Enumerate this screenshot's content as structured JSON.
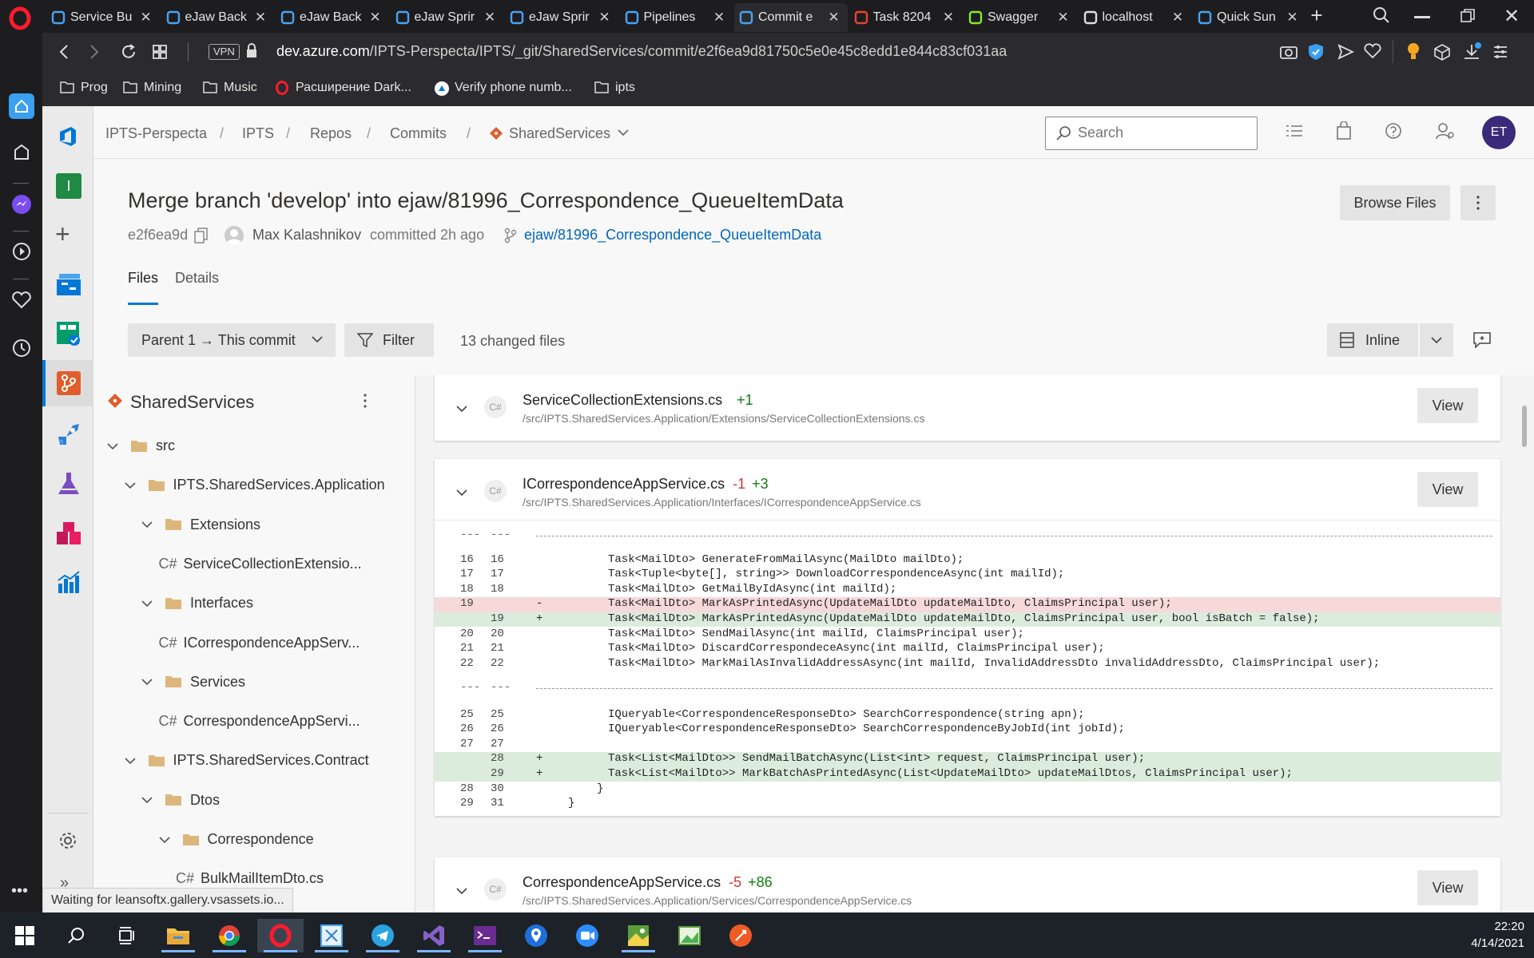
{
  "browser": {
    "tabs": [
      {
        "title": "Service Bu",
        "icon": "azure-devops-icon",
        "color": "#4aa3f0"
      },
      {
        "title": "eJaw Back",
        "icon": "azure-devops-icon",
        "color": "#4aa3f0"
      },
      {
        "title": "eJaw Back",
        "icon": "azure-devops-icon",
        "color": "#4aa3f0"
      },
      {
        "title": "eJaw Sprir",
        "icon": "azure-devops-icon",
        "color": "#4aa3f0"
      },
      {
        "title": "eJaw Sprir",
        "icon": "azure-devops-icon",
        "color": "#4aa3f0"
      },
      {
        "title": "Pipelines",
        "icon": "azure-pipelines-icon",
        "color": "#4aa3f0"
      },
      {
        "title": "Commit e",
        "icon": "azure-devops-icon",
        "color": "#4aa3f0"
      },
      {
        "title": "Task 8204",
        "icon": "gmail-icon",
        "color": "#ea4335"
      },
      {
        "title": "Swagger",
        "icon": "swagger-icon",
        "color": "#85ea2d"
      },
      {
        "title": "localhost",
        "icon": "document-icon",
        "color": "#dddddd"
      },
      {
        "title": "Quick Sun",
        "icon": "checkbox-icon",
        "color": "#4aa3f0"
      }
    ],
    "url_host": "dev.azure.com",
    "url_path": "/IPTS-Perspecta/IPTS/_git/SharedServices/commit/e2f6ea9d81750c5e0e45c8edd1e844c83cf031aa",
    "vpn_label": "VPN",
    "bookmarks": [
      {
        "label": "Prog",
        "icon": "folder-icon"
      },
      {
        "label": "Mining",
        "icon": "folder-icon"
      },
      {
        "label": "Music",
        "icon": "folder-icon"
      },
      {
        "label": "Расширение Dark...",
        "icon": "opera-icon"
      },
      {
        "label": "Verify phone numb...",
        "icon": "azure-icon"
      },
      {
        "label": "ipts",
        "icon": "folder-icon"
      }
    ],
    "status_text": "Waiting for leansoftx.gallery.vsassets.io..."
  },
  "header": {
    "breadcrumbs": [
      "IPTS-Perspecta",
      "IPTS",
      "Repos",
      "Commits",
      "SharedServices"
    ],
    "search_placeholder": "Search",
    "avatar_initials": "ET",
    "avatar_color": "#3b2a7a"
  },
  "commit": {
    "title": "Merge branch 'develop' into ejaw/81996_Correspondence_QueueItemData",
    "hash": "e2f6ea9d",
    "author": "Max Kalashnikov",
    "action": "committed 2h ago",
    "branch": "ejaw/81996_Correspondence_QueueItemData",
    "browse_files_label": "Browse Files",
    "tabs": [
      "Files",
      "Details"
    ]
  },
  "toolbar": {
    "parent_label": "Parent 1 → This commit",
    "filter_label": "Filter",
    "changed_files": "13 changed files",
    "view_mode": "Inline"
  },
  "tree": {
    "repo": "SharedServices",
    "nodes": [
      {
        "label": "src",
        "type": "folder",
        "level": 0
      },
      {
        "label": "IPTS.SharedServices.Application",
        "type": "folder",
        "level": 1
      },
      {
        "label": "Extensions",
        "type": "folder",
        "level": 2
      },
      {
        "label": "ServiceCollectionExtensio...",
        "type": "file",
        "level": 3
      },
      {
        "label": "Interfaces",
        "type": "folder",
        "level": 2
      },
      {
        "label": "ICorrespondenceAppServ...",
        "type": "file",
        "level": 3
      },
      {
        "label": "Services",
        "type": "folder",
        "level": 2
      },
      {
        "label": "CorrespondenceAppServi...",
        "type": "file",
        "level": 3
      },
      {
        "label": "IPTS.SharedServices.Contract",
        "type": "folder",
        "level": 1
      },
      {
        "label": "Dtos",
        "type": "folder",
        "level": 2
      },
      {
        "label": "Correspondence",
        "type": "folder",
        "level": 3
      },
      {
        "label": "BulkMailItemDto.cs",
        "type": "file",
        "level": 4
      }
    ],
    "file_prefix": "C#"
  },
  "files": [
    {
      "name": "ServiceCollectionExtensions.cs",
      "minus": "",
      "plus": "+1",
      "path": "/src/IPTS.SharedServices.Application/Extensions/ServiceCollectionExtensions.cs",
      "view": "View",
      "lang": "C#"
    },
    {
      "name": "ICorrespondenceAppService.cs",
      "minus": "-1",
      "plus": "+3",
      "path": "/src/IPTS.SharedServices.Application/Interfaces/ICorrespondenceAppService.cs",
      "view": "View",
      "lang": "C#",
      "diff": [
        {
          "type": "sep",
          "a": "---",
          "b": "---"
        },
        {
          "type": "ctx",
          "a": "16",
          "b": "16",
          "mk": "",
          "code": "Task<MailDto> GenerateFromMailAsync(MailDto mailDto);"
        },
        {
          "type": "ctx",
          "a": "17",
          "b": "17",
          "mk": "",
          "code": "Task<Tuple<byte[], string>> DownloadCorrespondenceAsync(int mailId);"
        },
        {
          "type": "ctx",
          "a": "18",
          "b": "18",
          "mk": "",
          "code": "Task<MailDto> GetMailByIdAsync(int mailId);"
        },
        {
          "type": "del",
          "a": "19",
          "b": "",
          "mk": "-",
          "code": "Task<MailDto> MarkAsPrintedAsync(UpdateMailDto updateMailDto, ClaimsPrincipal user);"
        },
        {
          "type": "add",
          "a": "",
          "b": "19",
          "mk": "+",
          "code": "Task<MailDto> MarkAsPrintedAsync(UpdateMailDto updateMailDto, ClaimsPrincipal user, bool isBatch = false);"
        },
        {
          "type": "ctx",
          "a": "20",
          "b": "20",
          "mk": "",
          "code": "Task<MailDto> SendMailAsync(int mailId, ClaimsPrincipal user);"
        },
        {
          "type": "ctx",
          "a": "21",
          "b": "21",
          "mk": "",
          "code": "Task<MailDto> DiscardCorrespondeceAsync(int mailId, ClaimsPrincipal user);"
        },
        {
          "type": "ctx",
          "a": "22",
          "b": "22",
          "mk": "",
          "code": "Task<MailDto> MarkMailAsInvalidAddressAsync(int mailId, InvalidAddressDto invalidAddressDto, ClaimsPrincipal user);"
        },
        {
          "type": "sep",
          "a": "---",
          "b": "---"
        },
        {
          "type": "ctx",
          "a": "25",
          "b": "25",
          "mk": "",
          "code": "IQueryable<CorrespondenceResponseDto> SearchCorrespondence(string apn);"
        },
        {
          "type": "ctx",
          "a": "26",
          "b": "26",
          "mk": "",
          "code": "IQueryable<CorrespondenceResponseDto> SearchCorrespondenceByJobId(int jobId);"
        },
        {
          "type": "ctx",
          "a": "27",
          "b": "27",
          "mk": "",
          "code": ""
        },
        {
          "type": "add",
          "a": "",
          "b": "28",
          "mk": "+",
          "code": "Task<List<MailDto>> SendMailBatchAsync(List<int> request, ClaimsPrincipal user);"
        },
        {
          "type": "add",
          "a": "",
          "b": "29",
          "mk": "+",
          "code": "Task<List<MailDto>> MarkBatchAsPrintedAsync(List<UpdateMailDto> updateMailDtos, ClaimsPrincipal user);"
        },
        {
          "type": "ctx2",
          "a": "28",
          "b": "30",
          "mk": "",
          "code": "}"
        },
        {
          "type": "ctx3",
          "a": "29",
          "b": "31",
          "mk": "",
          "code": "}"
        }
      ]
    },
    {
      "name": "CorrespondenceAppService.cs",
      "minus": "-5",
      "plus": "+86",
      "path": "/src/IPTS.SharedServices.Application/Services/CorrespondenceAppService.cs",
      "view": "View",
      "lang": "C#"
    }
  ],
  "taskbar": {
    "time": "22:20",
    "date": "4/14/2021"
  }
}
